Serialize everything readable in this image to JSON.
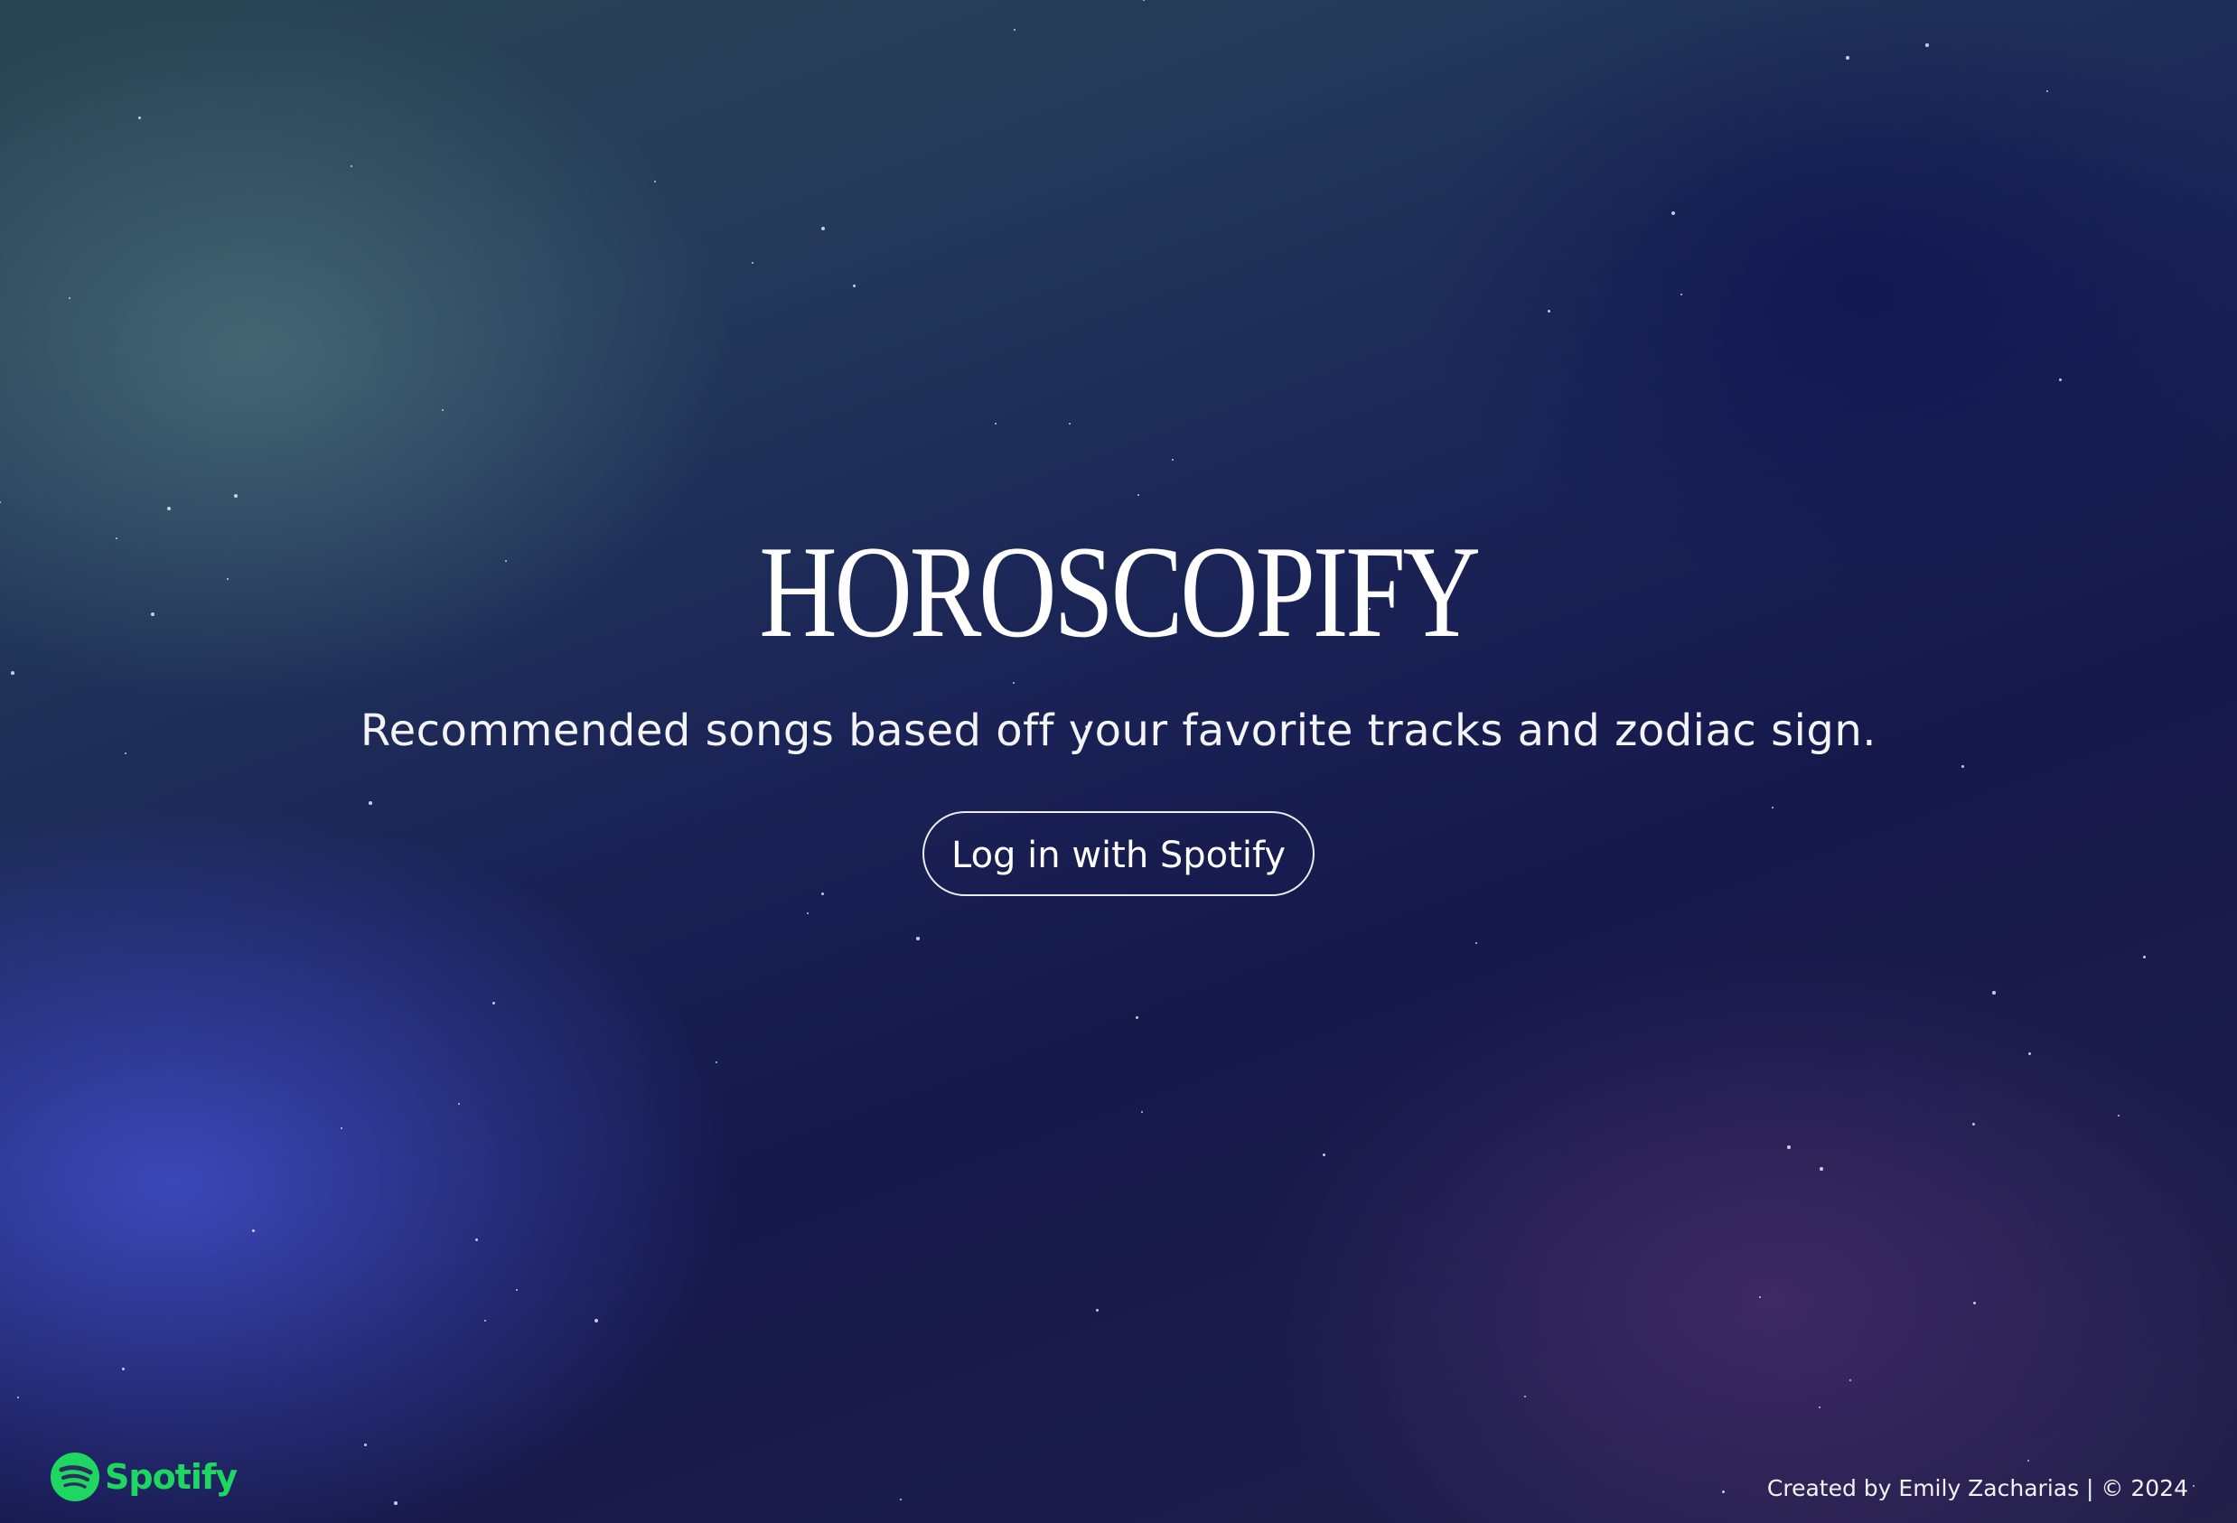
{
  "hero": {
    "title": "HOROSCOPIFY",
    "subtitle": "Recommended songs based off your favorite tracks and zodiac sign.",
    "login_button": "Log in with Spotify"
  },
  "footer": {
    "brand_logo_text": "Spotify",
    "credit": "Created by Emily Zacharias | © 2024"
  },
  "colors": {
    "spotify_green": "#1ed760",
    "text": "#ffffff"
  }
}
